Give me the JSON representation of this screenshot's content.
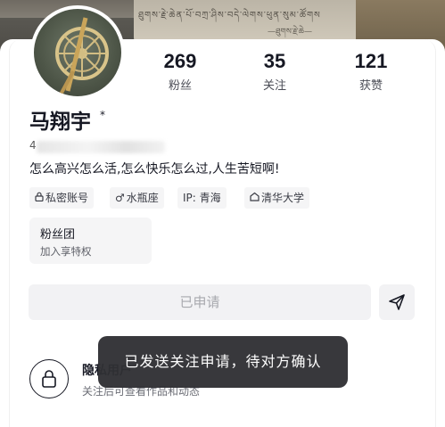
{
  "banner": {
    "inscription_line1": "ཐུགས་རྗེ་ཆེན་པོ་བཀྲ་ཤིས་བདེ་ལེགས་ཕུན་སུམ་ཚོགས",
    "inscription_line2": "—ཐུགས་རྗེ་ཆེ—"
  },
  "profile": {
    "name": "马翔宇",
    "name_mark": "*",
    "id_prefix": "4",
    "bio": "怎么高兴怎么活,怎么快乐怎么过,人生苦短啊!"
  },
  "stats": [
    {
      "value": "269",
      "label": "粉丝"
    },
    {
      "value": "35",
      "label": "关注"
    },
    {
      "value": "121",
      "label": "获赞"
    }
  ],
  "tags": [
    {
      "icon": "lock-icon",
      "glyph": "🔒",
      "label": "私密账号"
    },
    {
      "icon": "male-icon",
      "glyph": "♂",
      "label": "水瓶座"
    },
    {
      "icon": "",
      "glyph": "",
      "label": "IP: 青海"
    },
    {
      "icon": "school-icon",
      "glyph": "⌂",
      "label": "清华大学"
    }
  ],
  "fanclub": {
    "title": "粉丝团",
    "subtitle": "加入享特权"
  },
  "actions": {
    "applied_label": "已申请",
    "send_icon": "send-icon"
  },
  "private_section": {
    "title": "隐私用户",
    "subtitle": "关注后可查看作品和动态"
  },
  "toast": {
    "message": "已发送关注申请，待对方确认"
  },
  "colors": {
    "card_background": "#ffffff",
    "toast_background": "#303034",
    "button_background": "#f2f2f4",
    "button_text": "#a8a9ae"
  }
}
